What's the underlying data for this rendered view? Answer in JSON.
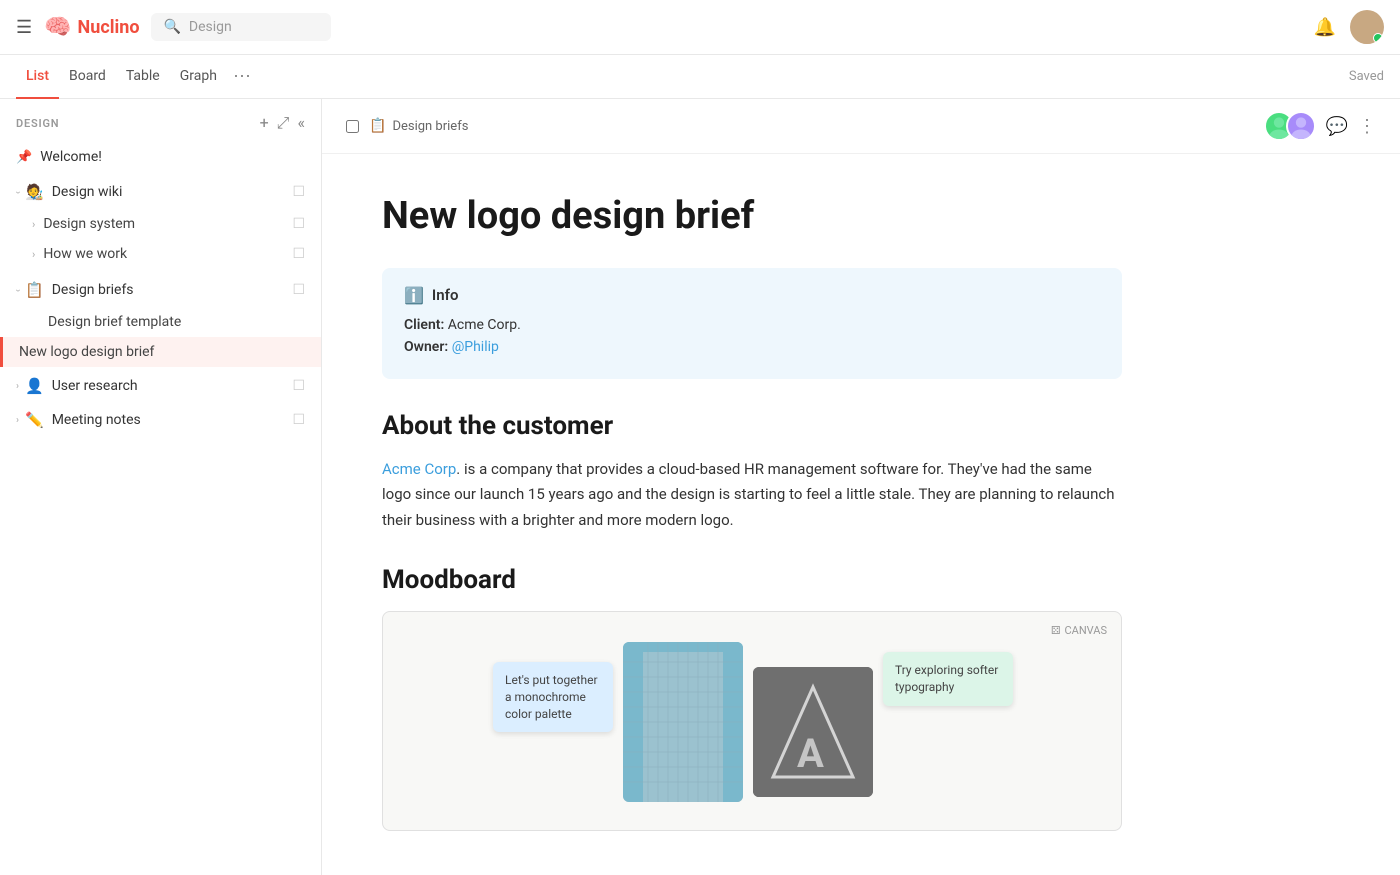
{
  "topnav": {
    "logo_text": "Nuclino",
    "search_placeholder": "Design"
  },
  "tabbar": {
    "tabs": [
      {
        "label": "List",
        "active": true
      },
      {
        "label": "Board",
        "active": false
      },
      {
        "label": "Table",
        "active": false
      },
      {
        "label": "Graph",
        "active": false
      }
    ],
    "saved_label": "Saved"
  },
  "sidebar": {
    "section_title": "DESIGN",
    "pinned_item": {
      "label": "Welcome!",
      "icon": "📌"
    },
    "groups": [
      {
        "label": "Design wiki",
        "icon": "🧑‍🎨",
        "expanded": true,
        "children": [
          {
            "label": "Design system"
          },
          {
            "label": "How we work"
          }
        ]
      },
      {
        "label": "Design briefs",
        "icon": "📋",
        "expanded": true,
        "children": [
          {
            "label": "Design brief template"
          },
          {
            "label": "New logo design brief",
            "active": true
          }
        ]
      },
      {
        "label": "User research",
        "icon": "👤",
        "expanded": false,
        "children": []
      },
      {
        "label": "Meeting notes",
        "icon": "✏️",
        "expanded": false,
        "children": []
      }
    ]
  },
  "breadcrumb": {
    "icon": "📋",
    "label": "Design briefs"
  },
  "document": {
    "title": "New logo design brief",
    "info_heading": "Info",
    "client_label": "Client:",
    "client_value": "Acme Corp.",
    "owner_label": "Owner:",
    "owner_value": "@Philip",
    "about_heading": "About the customer",
    "about_link_text": "Acme Corp",
    "about_text": ". is a company that provides a cloud-based HR management software for. They've had the same logo since our launch 15 years ago and the design is starting to feel a little stale. They are planning to relaunch their business with a brighter and more modern logo.",
    "moodboard_heading": "Moodboard",
    "canvas_label": "CANVAS",
    "sticky1_text": "Let's put together a monochrome color palette",
    "sticky2_text": "Try exploring softer typography"
  },
  "icons": {
    "hamburger": "☰",
    "logo": "🧠",
    "search": "🔍",
    "bell": "🔔",
    "chevron_down": "›",
    "chevron_right": "›",
    "plus": "+",
    "expand": "⤢",
    "collapse": "«",
    "info_circle": "ℹ",
    "comment": "💬",
    "more_vert": "⋮",
    "canvas_icon": "⚄"
  }
}
